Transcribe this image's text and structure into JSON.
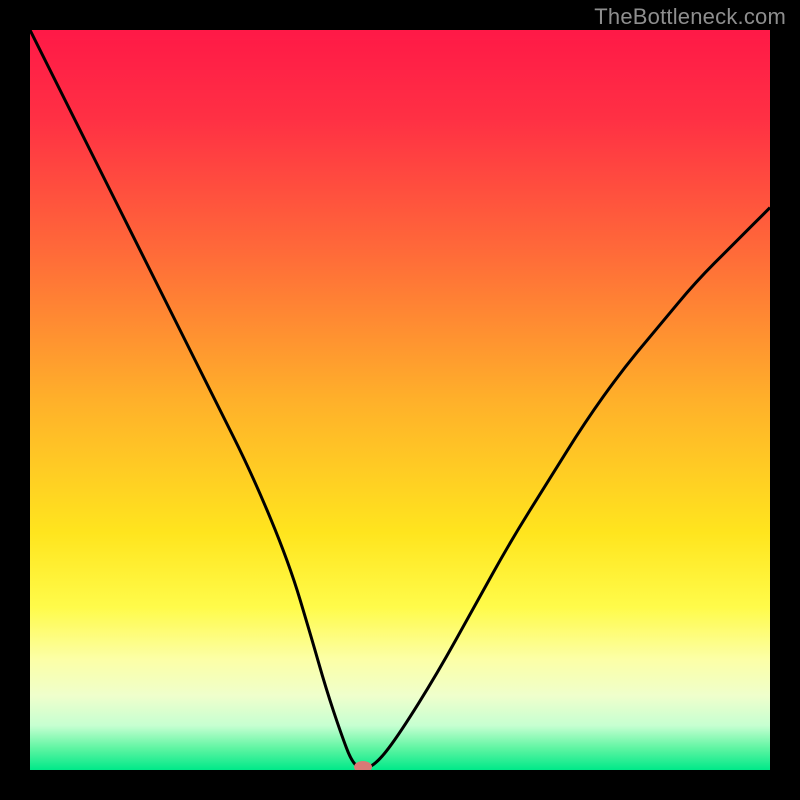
{
  "attribution": "TheBottleneck.com",
  "chart_data": {
    "type": "line",
    "title": "",
    "xlabel": "",
    "ylabel": "",
    "xlim": [
      0,
      100
    ],
    "ylim": [
      0,
      100
    ],
    "legend": false,
    "grid": false,
    "background_gradient": {
      "stops": [
        {
          "offset": 0.0,
          "color": "#ff1947"
        },
        {
          "offset": 0.12,
          "color": "#ff3044"
        },
        {
          "offset": 0.3,
          "color": "#ff6a39"
        },
        {
          "offset": 0.5,
          "color": "#ffb02a"
        },
        {
          "offset": 0.68,
          "color": "#ffe51e"
        },
        {
          "offset": 0.78,
          "color": "#fffb4a"
        },
        {
          "offset": 0.85,
          "color": "#fcffa6"
        },
        {
          "offset": 0.9,
          "color": "#efffcc"
        },
        {
          "offset": 0.94,
          "color": "#c6ffd1"
        },
        {
          "offset": 0.97,
          "color": "#61f5a3"
        },
        {
          "offset": 1.0,
          "color": "#00e989"
        }
      ]
    },
    "series": [
      {
        "name": "bottleneck-curve",
        "color": "#000000",
        "x": [
          0,
          5,
          10,
          15,
          20,
          25,
          30,
          35,
          38,
          40,
          42,
          43.5,
          45,
          47,
          50,
          55,
          60,
          65,
          70,
          75,
          80,
          85,
          90,
          95,
          100
        ],
        "values": [
          100,
          90,
          80,
          70,
          60,
          50,
          40,
          28,
          18,
          11,
          5,
          1,
          0,
          1,
          5,
          13,
          22,
          31,
          39,
          47,
          54,
          60,
          66,
          71,
          76
        ]
      }
    ],
    "marker": {
      "x": 45,
      "y": 0,
      "color": "#d97a76",
      "rx": 9,
      "ry": 6
    }
  }
}
